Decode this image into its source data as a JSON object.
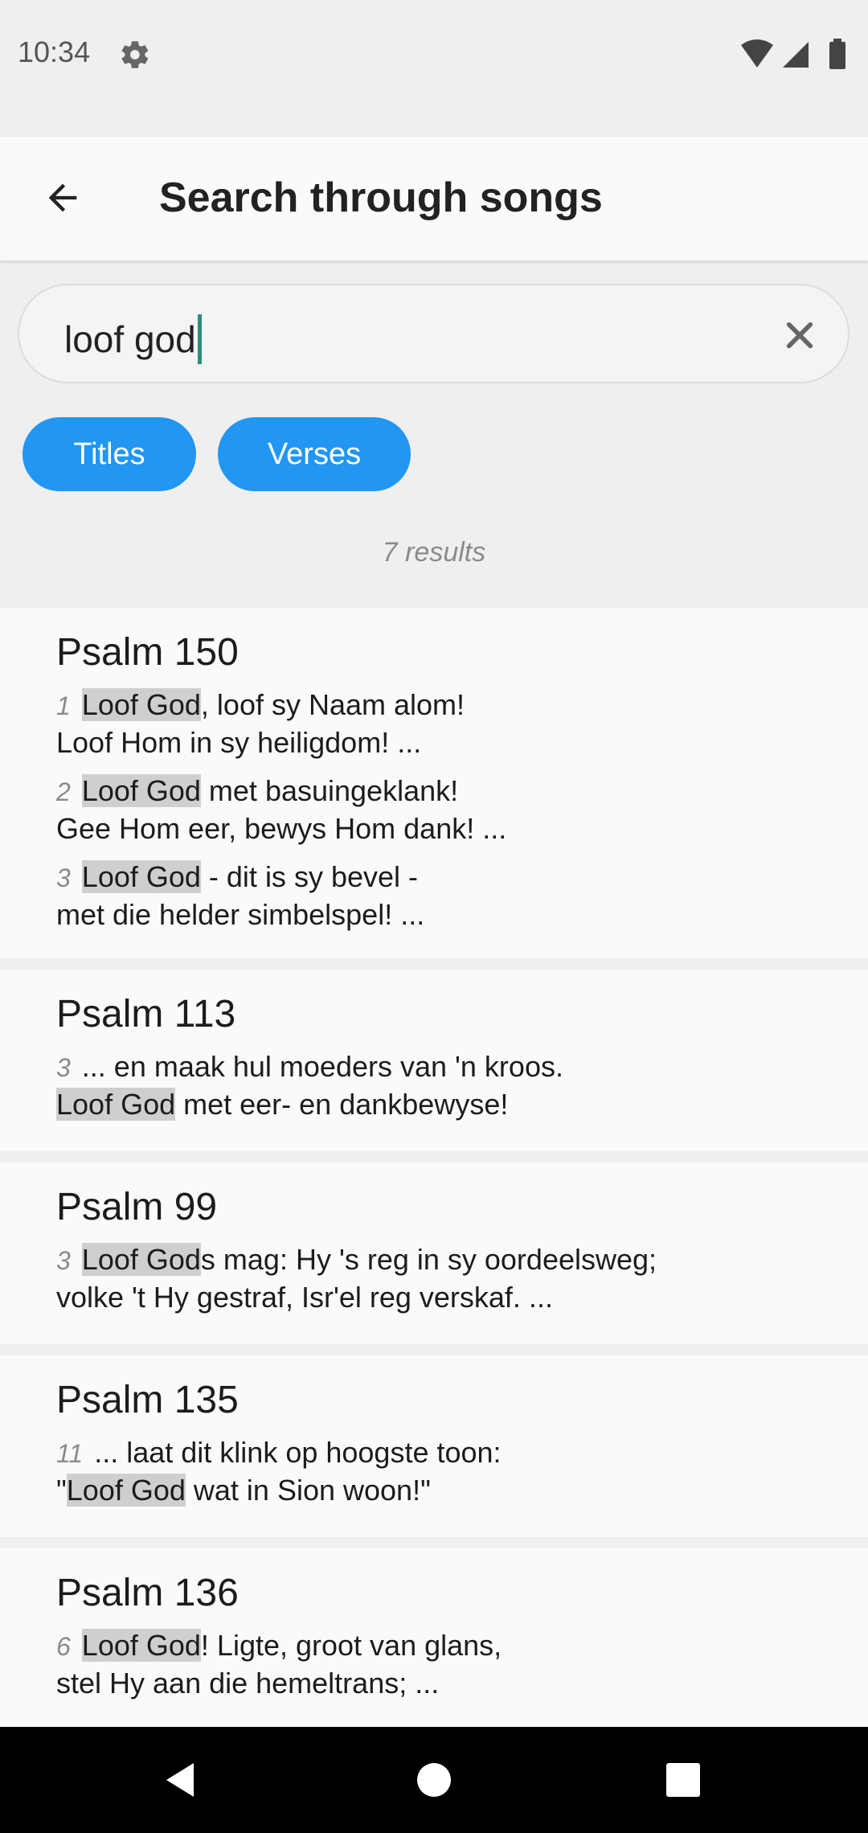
{
  "status": {
    "time": "10:34"
  },
  "header": {
    "title": "Search through songs"
  },
  "search": {
    "value": "loof god"
  },
  "filters": {
    "titles": "Titles",
    "verses": "Verses"
  },
  "results_count": "7 results",
  "results": [
    {
      "title": "Psalm 150",
      "verses": [
        {
          "num": "1",
          "pre": "",
          "hl": "Loof God",
          "post": ", loof sy Naam alom!",
          "line2": "Loof Hom in sy heiligdom! ..."
        },
        {
          "num": "2",
          "pre": "",
          "hl": "Loof God",
          "post": " met basuingeklank!",
          "line2": "Gee Hom eer, bewys Hom dank! ..."
        },
        {
          "num": "3",
          "pre": "",
          "hl": "Loof God",
          "post": " - dit is sy bevel -",
          "line2": "met die helder simbelspel! ..."
        }
      ]
    },
    {
      "title": "Psalm 113",
      "verses": [
        {
          "num": "3",
          "line1": "... en maak hul moeders van 'n kroos.",
          "l2pre": "",
          "l2hl": "Loof God",
          "l2post": " met eer- en dankbewyse!"
        }
      ]
    },
    {
      "title": "Psalm 99",
      "verses": [
        {
          "num": "3",
          "pre": "",
          "hl": "Loof God",
          "post": "s mag: Hy 's reg in sy oordeelsweg;",
          "line2": "volke 't Hy gestraf, Isr'el reg verskaf. ..."
        }
      ]
    },
    {
      "title": "Psalm 135",
      "verses": [
        {
          "num": "11",
          "line1": "... laat dit klink op hoogste toon:",
          "l2pre": "\"",
          "l2hl": "Loof God",
          "l2post": " wat in Sion woon!\""
        }
      ]
    },
    {
      "title": "Psalm 136",
      "verses": [
        {
          "num": "6",
          "pre": "",
          "hl": "Loof God",
          "post": "! Ligte, groot van glans,",
          "line2": "stel Hy aan die hemeltrans; ..."
        }
      ]
    }
  ]
}
